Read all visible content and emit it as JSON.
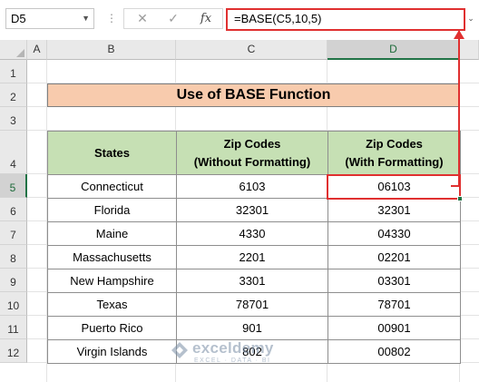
{
  "formula_bar": {
    "name_box": "D5",
    "cancel_icon": "✕",
    "enter_icon": "✓",
    "fx_label": "fx",
    "formula": "=BASE(C5,10,5)"
  },
  "columns": [
    "A",
    "B",
    "C",
    "D"
  ],
  "rows": [
    "1",
    "2",
    "3",
    "4",
    "5",
    "6",
    "7",
    "8",
    "9",
    "10",
    "11",
    "12"
  ],
  "selected_cell": {
    "column": "D",
    "row": "5"
  },
  "title": "Use of BASE Function",
  "table": {
    "headers": [
      [
        "States"
      ],
      [
        "Zip Codes",
        "(Without Formatting)"
      ],
      [
        "Zip Codes",
        "(With Formatting)"
      ]
    ],
    "rows": [
      [
        "Connecticut",
        "6103",
        "06103"
      ],
      [
        "Florida",
        "32301",
        "32301"
      ],
      [
        "Maine",
        "4330",
        "04330"
      ],
      [
        "Massachusetts",
        "2201",
        "02201"
      ],
      [
        "New Hampshire",
        "3301",
        "03301"
      ],
      [
        "Texas",
        "78701",
        "78701"
      ],
      [
        "Puerto Rico",
        "901",
        "00901"
      ],
      [
        "Virgin Islands",
        "802",
        "00802"
      ]
    ]
  },
  "watermark": {
    "name": "exceldemy",
    "tagline": "EXCEL · DATA · BI"
  },
  "colors": {
    "accent_red": "#e03030",
    "title_fill": "#f8cbad",
    "header_fill": "#c6e0b4",
    "excel_green": "#217346"
  }
}
